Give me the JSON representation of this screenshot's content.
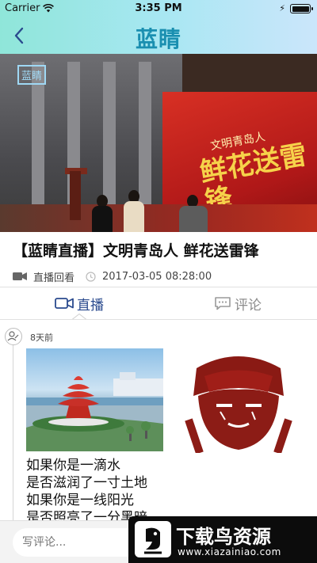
{
  "status_bar": {
    "carrier": "Carrier",
    "time": "3:35 PM"
  },
  "nav": {
    "logo_text": "蓝睛"
  },
  "video": {
    "watermark": "蓝睛",
    "stage_headline": "鲜花送雷锋",
    "stage_sub": "文明青岛人"
  },
  "article": {
    "title": "【蓝睛直播】文明青岛人 鲜花送雷锋",
    "category": "直播回看",
    "datetime": "2017-03-05 08:28:00"
  },
  "tabs": [
    {
      "label": "直播",
      "icon": "video-camera-icon",
      "active": true
    },
    {
      "label": "评论",
      "icon": "comment-bubble-icon",
      "active": false
    }
  ],
  "feed": {
    "posts": [
      {
        "time_ago": "8天前",
        "lines": [
          "如果你是一滴水",
          "是否滋润了一寸土地",
          "如果你是一线阳光",
          "是否照亮了一分黑暗"
        ]
      }
    ]
  },
  "comment_bar": {
    "placeholder": "写评论..."
  },
  "download_banner": {
    "title": "下载鸟资源",
    "url": "www.xiazainiao.com"
  },
  "colors": {
    "accent": "#2a4a8e",
    "nav_gradient_start": "#8fe6d9",
    "nav_gradient_end": "#cbe6fb"
  }
}
